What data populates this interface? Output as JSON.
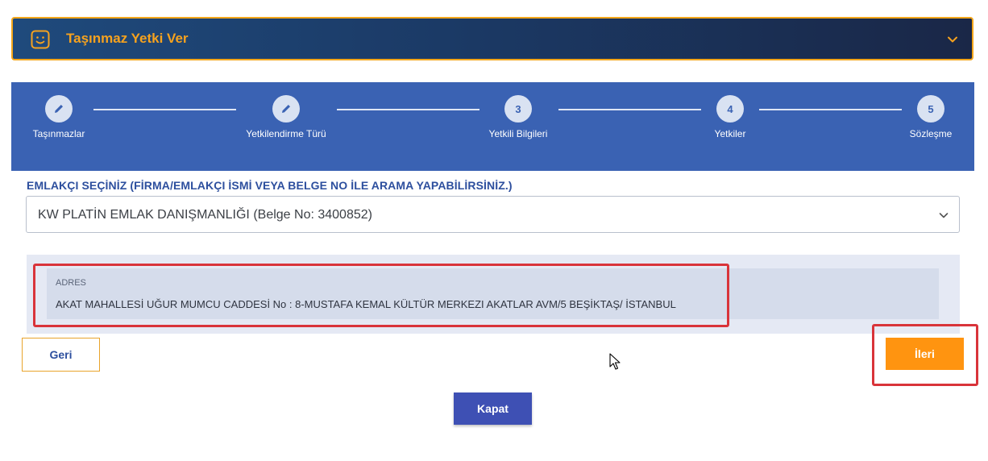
{
  "header": {
    "title": "Taşınmaz Yetki Ver",
    "icon": "smile-icon",
    "accent_color": "#f6a21e"
  },
  "stepper": {
    "steps": [
      {
        "label": "Taşınmazlar",
        "marker": "✎",
        "state": "completed"
      },
      {
        "label": "Yetkilendirme Türü",
        "marker": "✎",
        "state": "completed"
      },
      {
        "label": "Yetkili Bilgileri",
        "marker": "3",
        "state": "current"
      },
      {
        "label": "Yetkiler",
        "marker": "4",
        "state": "pending"
      },
      {
        "label": "Sözleşme",
        "marker": "5",
        "state": "pending"
      }
    ]
  },
  "realtor": {
    "label": "EMLAKÇI SEÇİNİZ (FİRMA/EMLAKÇI İSMİ VEYA BELGE NO İLE ARAMA YAPABİLİRSİNİZ.)",
    "selected": "KW PLATİN EMLAK DANIŞMANLIĞI (Belge No: 3400852)"
  },
  "address": {
    "title": "ADRES",
    "text": "AKAT MAHALLESİ UĞUR MUMCU CADDESİ No : 8-MUSTAFA KEMAL KÜLTÜR MERKEZI AKATLAR AVM/5 BEŞİKTAŞ/ İSTANBUL"
  },
  "buttons": {
    "back": "Geri",
    "next": "İleri",
    "close": "Kapat"
  }
}
